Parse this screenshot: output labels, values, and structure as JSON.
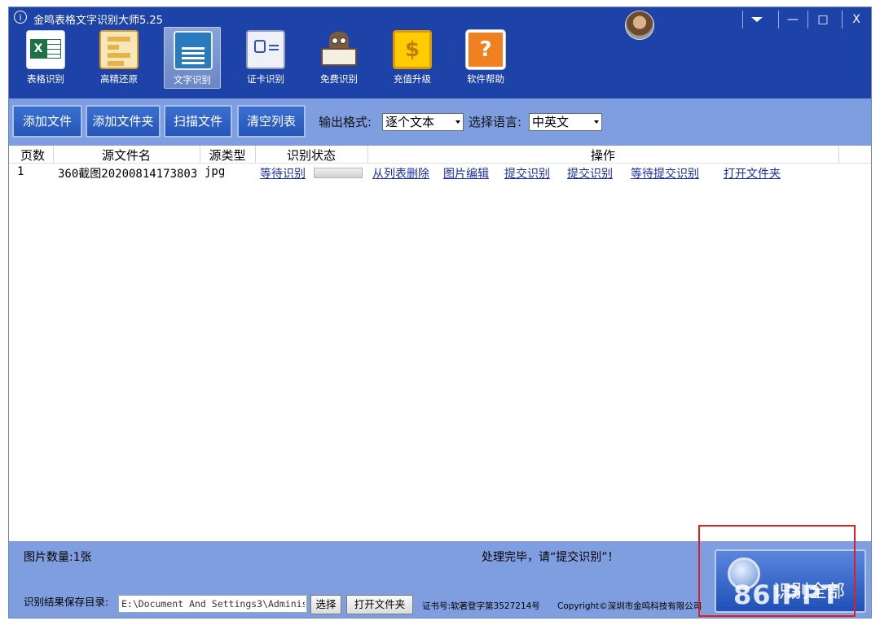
{
  "window": {
    "title": "金鸣表格文字识别大师5.25",
    "controls": [
      "minimize-dropdown",
      "—",
      "□",
      "X"
    ]
  },
  "nav": [
    {
      "label": "表格识别",
      "icon": "excel-icon",
      "active": false
    },
    {
      "label": "高精还原",
      "icon": "document-layout-icon",
      "active": false
    },
    {
      "label": "文字识别",
      "icon": "text-document-icon",
      "active": true
    },
    {
      "label": "证卡识别",
      "icon": "id-card-icon",
      "active": false
    },
    {
      "label": "免费识别",
      "icon": "owl-book-icon",
      "active": false
    },
    {
      "label": "充值升级",
      "icon": "coin-icon",
      "active": false
    },
    {
      "label": "软件帮助",
      "icon": "help-icon",
      "active": false
    }
  ],
  "toolbar": {
    "add_file": "添加文件",
    "add_folder": "添加文件夹",
    "scan_file": "扫描文件",
    "clear_list": "清空列表",
    "output_format_label": "输出格式:",
    "output_format_value": "逐个文本",
    "language_label": "选择语言:",
    "language_value": "中英文"
  },
  "table": {
    "headers": [
      "页数",
      "源文件名",
      "源类型",
      "识别状态",
      "操作"
    ],
    "rows": [
      {
        "page": "1",
        "filename": "360截图20200814173803",
        "type": "jpg",
        "status": "等待识别",
        "progress": 0,
        "actions": [
          "从列表删除",
          "图片编辑",
          "提交识别",
          "提交识别",
          "等待提交识别",
          "打开文件夹"
        ]
      }
    ]
  },
  "bottom": {
    "image_count": "图片数量:1张",
    "status_message": "处理完毕，请“提交识别”！",
    "save_dir_label": "识别结果保存目录:",
    "save_dir_value": "E:\\Document And Settings3\\Administ",
    "select_button": "选择",
    "open_folder_button": "打开文件夹",
    "cert_number": "证书号:软著登字第3527214号",
    "copyright": "Copyright©深圳市金鸣科技有限公司",
    "recognize_all_button": "识别全部"
  },
  "watermark": "86IPPT",
  "colors": {
    "title_bar": "#1e43a8",
    "toolbar": "#7f9ee0",
    "button": "#2556b8",
    "link": "#1a2f9e",
    "highlight_box": "#e02020"
  }
}
